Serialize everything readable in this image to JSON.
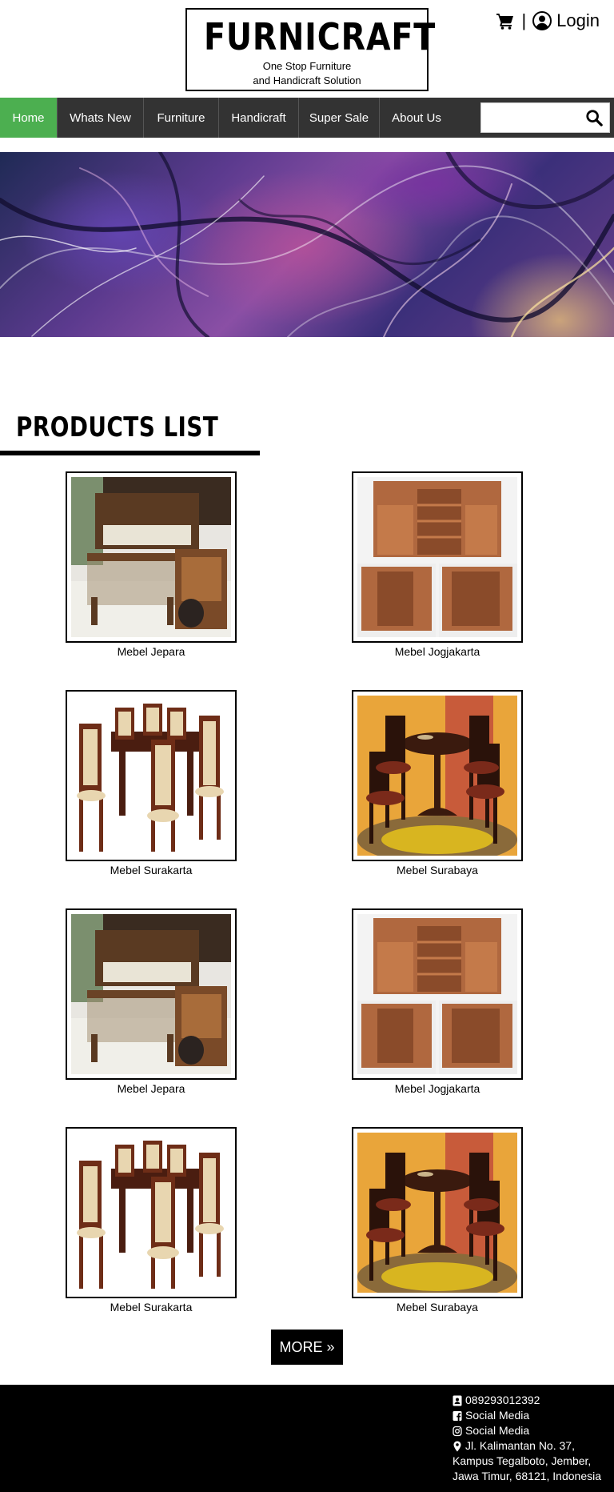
{
  "brand": {
    "name": "FURNICRAFT",
    "tagline_line1": "One Stop Furniture",
    "tagline_line2": "and Handicraft Solution"
  },
  "topbar": {
    "separator": "|",
    "login_label": "Login"
  },
  "nav": {
    "items": [
      {
        "label": "Home",
        "active": true
      },
      {
        "label": "Whats New",
        "active": false
      },
      {
        "label": "Furniture",
        "active": false
      },
      {
        "label": "Handicraft",
        "active": false
      },
      {
        "label": "Super Sale",
        "active": false
      },
      {
        "label": "About Us",
        "active": false
      }
    ],
    "search_value": ""
  },
  "colors": {
    "nav_bg": "#333333",
    "active_bg": "#4caf50",
    "footer_bg": "#000000"
  },
  "products_section": {
    "title": "PRODUCTS LIST",
    "items": [
      {
        "name": "Mebel Jepara",
        "image": "wooden-sofa-set"
      },
      {
        "name": "Mebel Jogjakarta",
        "image": "wooden-cabinet"
      },
      {
        "name": "Mebel Surakarta",
        "image": "dining-table-chairs"
      },
      {
        "name": "Mebel Surabaya",
        "image": "round-table-chairs"
      },
      {
        "name": "Mebel Jepara",
        "image": "wooden-sofa-set"
      },
      {
        "name": "Mebel Jogjakarta",
        "image": "wooden-cabinet"
      },
      {
        "name": "Mebel Surakarta",
        "image": "dining-table-chairs"
      },
      {
        "name": "Mebel Surabaya",
        "image": "round-table-chairs"
      }
    ],
    "more_label": "MORE »"
  },
  "footer": {
    "phone": "089293012392",
    "facebook": "Social Media",
    "instagram": "Social Media",
    "address_line1": "Jl. Kalimantan No. 37,",
    "address_line2": "Kampus Tegalboto, Jember,",
    "address_line3": "Jawa Timur, 68121, Indonesia"
  }
}
